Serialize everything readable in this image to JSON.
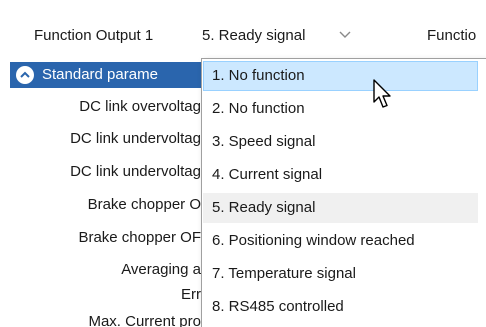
{
  "header": {
    "function_output_1_label": "Function Output 1",
    "function_output_1_value": "5. Ready signal",
    "function_output_2_label_partial": "Functio"
  },
  "section": {
    "title": "Standard parame"
  },
  "params": [
    "DC link overvoltag",
    "DC link undervoltag",
    "DC link undervoltag",
    "Brake chopper O",
    "Brake chopper OF",
    "Averaging a",
    "Err",
    "Max. Current pro"
  ],
  "dropdown": {
    "options": [
      "1. No function",
      "2. No function",
      "3. Speed signal",
      "4. Current signal",
      "5. Ready signal",
      "6. Positioning window reached",
      "7. Temperature signal",
      "8. RS485 controlled"
    ],
    "hovered_index": 0,
    "selected_index": 4
  },
  "colors": {
    "section_header_bg": "#2a65ad",
    "hover_bg": "#cce8ff",
    "selected_bg": "#f0f0f0"
  },
  "icons": {
    "combo_chevron": "chevron-down-icon",
    "section_toggle": "collapse-icon",
    "cursor": "mouse-pointer-icon"
  }
}
